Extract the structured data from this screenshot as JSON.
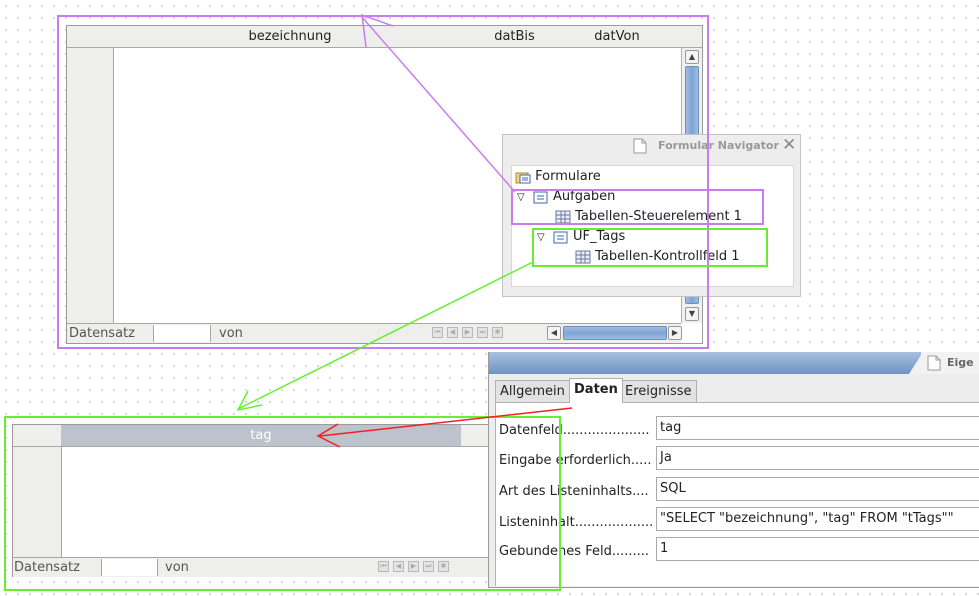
{
  "grid_top": {
    "columns": [
      "bezeichnung",
      "datBis",
      "datVon"
    ],
    "status": {
      "record_label": "Datensatz",
      "of_label": "von"
    }
  },
  "grid_bottom": {
    "columns": [
      "tag"
    ],
    "status": {
      "record_label": "Datensatz",
      "of_label": "von"
    }
  },
  "navigator": {
    "title": "Formular Navigator",
    "tree": {
      "root": "Formulare",
      "form1": "Aufgaben",
      "form1_control": "Tabellen-Steuerelement  1",
      "form2": "UF_Tags",
      "form2_control": "Tabellen-Kontrollfeld  1"
    }
  },
  "properties": {
    "title": "Eige",
    "tabs": [
      "Allgemein",
      "Daten",
      "Ereignisse"
    ],
    "active_tab": "Daten",
    "rows": [
      {
        "label": "Datenfeld.....................",
        "value": "tag"
      },
      {
        "label": "Eingabe erforderlich.....",
        "value": "Ja"
      },
      {
        "label": "Art des Listeninhalts....",
        "value": "SQL"
      },
      {
        "label": "Listeninhalt...................",
        "value": "\"SELECT \"bezeichnung\", \"tag\" FROM \"tTags\"\""
      },
      {
        "label": "Gebundenes Feld.........",
        "value": "1"
      }
    ]
  },
  "colors": {
    "annotation_violet": "#c77df0",
    "annotation_green": "#66ee33",
    "annotation_red": "#ee2222",
    "scroll_thumb": "#7ea3d4"
  }
}
